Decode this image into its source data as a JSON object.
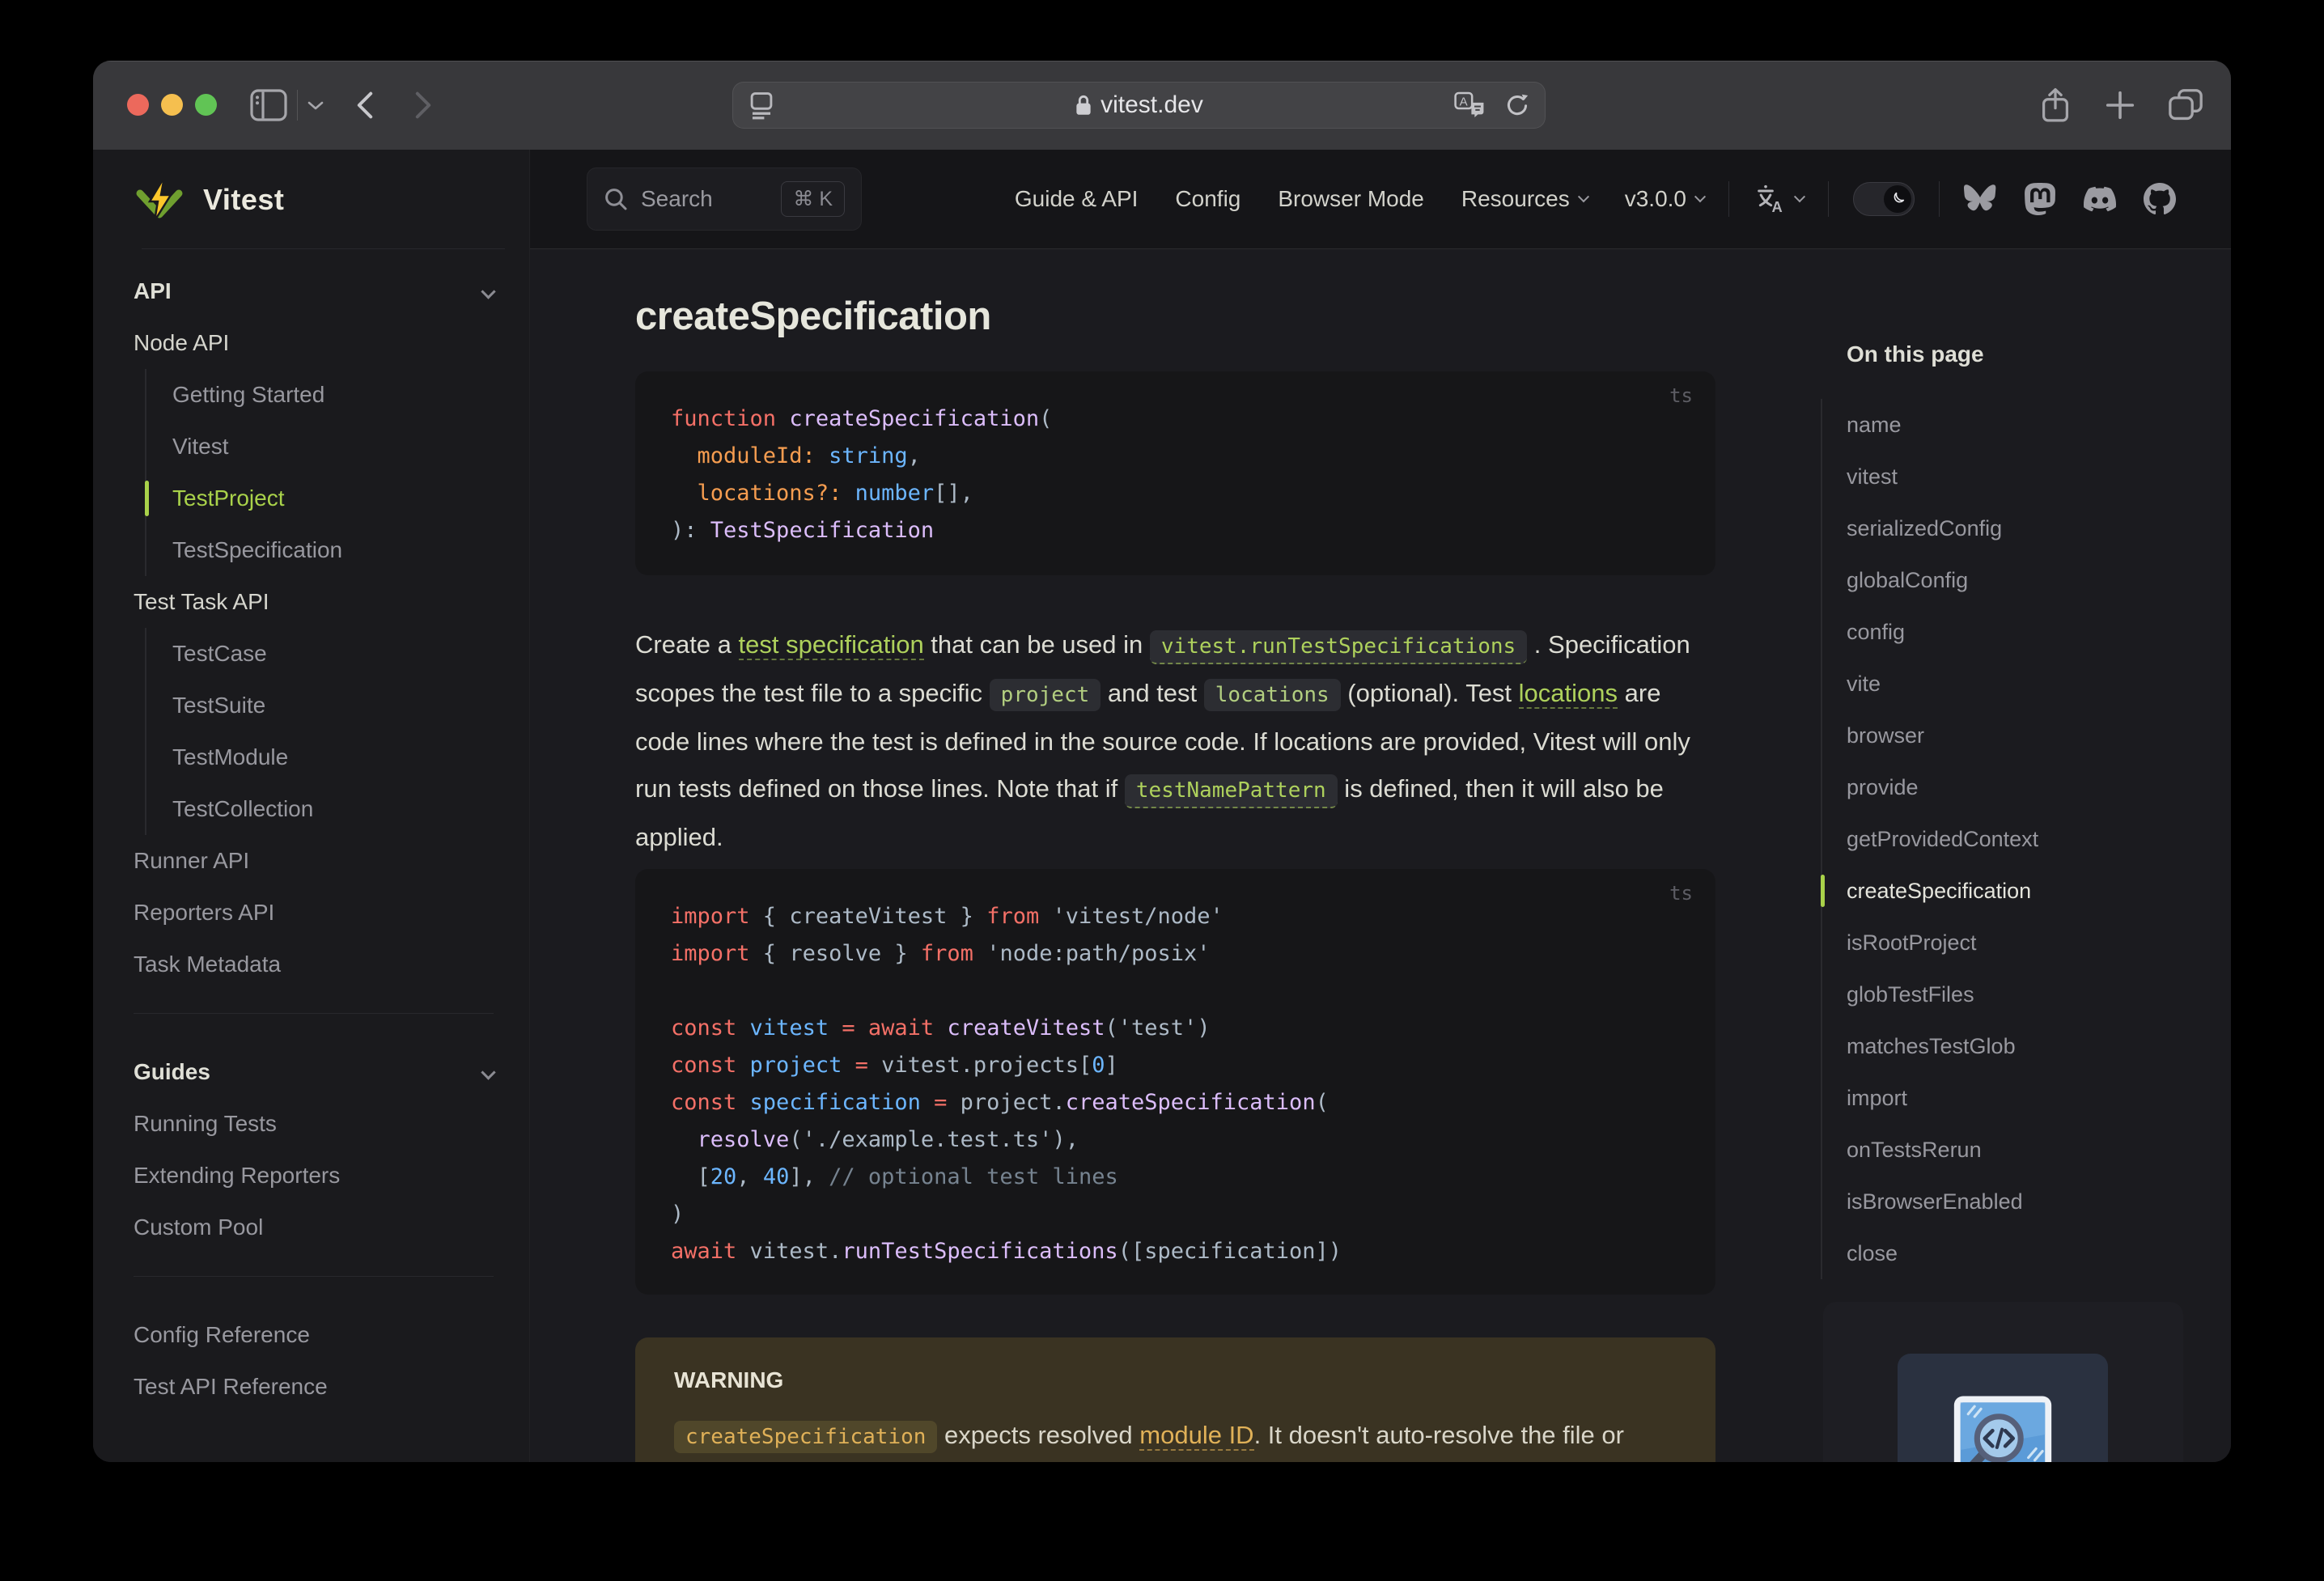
{
  "browser": {
    "url": "vitest.dev"
  },
  "nav": {
    "search_label": "Search",
    "search_shortcut": "⌘ K",
    "links": [
      {
        "label": "Guide & API"
      },
      {
        "label": "Config"
      },
      {
        "label": "Browser Mode"
      },
      {
        "label": "Resources",
        "chevron": true
      },
      {
        "label": "v3.0.0",
        "chevron": true
      }
    ],
    "socials": [
      "Bluesky",
      "Mastodon",
      "Discord",
      "GitHub"
    ]
  },
  "sidebar": {
    "logo_text": "Vitest",
    "sections": [
      {
        "title": "API",
        "items": [
          {
            "label": "Node API",
            "kind": "subheader"
          },
          {
            "label": "Getting Started",
            "kind": "nested"
          },
          {
            "label": "Vitest",
            "kind": "nested"
          },
          {
            "label": "TestProject",
            "kind": "nested",
            "active": true
          },
          {
            "label": "TestSpecification",
            "kind": "nested"
          },
          {
            "label": "Test Task API",
            "kind": "subheader"
          },
          {
            "label": "TestCase",
            "kind": "nested"
          },
          {
            "label": "TestSuite",
            "kind": "nested"
          },
          {
            "label": "TestModule",
            "kind": "nested"
          },
          {
            "label": "TestCollection",
            "kind": "nested"
          },
          {
            "label": "Runner API",
            "kind": "item"
          },
          {
            "label": "Reporters API",
            "kind": "item"
          },
          {
            "label": "Task Metadata",
            "kind": "item"
          }
        ]
      },
      {
        "title": "Guides",
        "items": [
          {
            "label": "Running Tests",
            "kind": "item"
          },
          {
            "label": "Extending Reporters",
            "kind": "item"
          },
          {
            "label": "Custom Pool",
            "kind": "item"
          }
        ]
      },
      {
        "title": null,
        "items": [
          {
            "label": "Config Reference",
            "kind": "item"
          },
          {
            "label": "Test API Reference",
            "kind": "item"
          }
        ]
      }
    ]
  },
  "page": {
    "heading": "createSpecification",
    "code_lang": "ts",
    "signature_code": {
      "lines": [
        [
          [
            "k",
            "function"
          ],
          [
            "p",
            " "
          ],
          [
            "f",
            "createSpecification"
          ],
          [
            "p",
            "("
          ]
        ],
        [
          [
            "p",
            "  "
          ],
          [
            "o",
            "moduleId:"
          ],
          [
            "p",
            " "
          ],
          [
            "b",
            "string"
          ],
          [
            "p",
            ","
          ]
        ],
        [
          [
            "p",
            "  "
          ],
          [
            "o",
            "locations?:"
          ],
          [
            "p",
            " "
          ],
          [
            "b",
            "number"
          ],
          [
            "p",
            "[],"
          ]
        ],
        [
          [
            "p",
            "): "
          ],
          [
            "f",
            "TestSpecification"
          ]
        ]
      ]
    },
    "paragraph": [
      [
        "t",
        "Create a "
      ],
      [
        "a",
        "test specification"
      ],
      [
        "t",
        " that can be used in "
      ],
      [
        "ac",
        "vitest.runTestSpecifications"
      ],
      [
        "t",
        " . Specification scopes the test file to a specific "
      ],
      [
        "c",
        "project"
      ],
      [
        "t",
        " and test "
      ],
      [
        "c",
        "locations"
      ],
      [
        "t",
        " (optional). Test "
      ],
      [
        "a",
        "locations"
      ],
      [
        "t",
        " are code lines where the test is defined in the source code. If locations are provided, Vitest will only run tests defined on those lines. Note that if "
      ],
      [
        "ac",
        "testNamePattern"
      ],
      [
        "t",
        " is defined, then it will also be applied."
      ]
    ],
    "example_code": {
      "lines": [
        [
          [
            "k",
            "import"
          ],
          [
            "p",
            " { "
          ],
          [
            "p",
            "createVitest"
          ],
          [
            "p",
            " } "
          ],
          [
            "k",
            "from"
          ],
          [
            "p",
            " "
          ],
          [
            "s",
            "'vitest/node'"
          ]
        ],
        [
          [
            "k",
            "import"
          ],
          [
            "p",
            " { "
          ],
          [
            "p",
            "resolve"
          ],
          [
            "p",
            " } "
          ],
          [
            "k",
            "from"
          ],
          [
            "p",
            " "
          ],
          [
            "s",
            "'node:path/posix'"
          ]
        ],
        [],
        [
          [
            "k",
            "const"
          ],
          [
            "p",
            " "
          ],
          [
            "b",
            "vitest"
          ],
          [
            "p",
            " "
          ],
          [
            "k",
            "="
          ],
          [
            "p",
            " "
          ],
          [
            "k",
            "await"
          ],
          [
            "p",
            " "
          ],
          [
            "f",
            "createVitest"
          ],
          [
            "p",
            "("
          ],
          [
            "s",
            "'test'"
          ],
          [
            "p",
            ")"
          ]
        ],
        [
          [
            "k",
            "const"
          ],
          [
            "p",
            " "
          ],
          [
            "b",
            "project"
          ],
          [
            "p",
            " "
          ],
          [
            "k",
            "="
          ],
          [
            "p",
            " "
          ],
          [
            "p",
            "vitest.projects["
          ],
          [
            "b",
            "0"
          ],
          [
            "p",
            "]"
          ]
        ],
        [
          [
            "k",
            "const"
          ],
          [
            "p",
            " "
          ],
          [
            "b",
            "specification"
          ],
          [
            "p",
            " "
          ],
          [
            "k",
            "="
          ],
          [
            "p",
            " "
          ],
          [
            "p",
            "project."
          ],
          [
            "f",
            "createSpecification"
          ],
          [
            "p",
            "("
          ]
        ],
        [
          [
            "p",
            "  "
          ],
          [
            "f",
            "resolve"
          ],
          [
            "p",
            "("
          ],
          [
            "s",
            "'./example.test.ts'"
          ],
          [
            "p",
            "),"
          ]
        ],
        [
          [
            "p",
            "  ["
          ],
          [
            "b",
            "20"
          ],
          [
            "p",
            ", "
          ],
          [
            "b",
            "40"
          ],
          [
            "p",
            "], "
          ],
          [
            "c",
            "// optional test lines"
          ]
        ],
        [
          [
            "p",
            ")"
          ]
        ],
        [
          [
            "k",
            "await"
          ],
          [
            "p",
            " vitest."
          ],
          [
            "f",
            "runTestSpecifications"
          ],
          [
            "p",
            "(["
          ],
          [
            "p",
            "specification"
          ],
          [
            "p",
            "])"
          ]
        ]
      ]
    },
    "warning": {
      "title": "WARNING",
      "body": [
        [
          "cw",
          "createSpecification"
        ],
        [
          "t",
          " expects resolved "
        ],
        [
          "aw",
          "module ID"
        ],
        [
          "t",
          ". It doesn't auto-resolve the file or check that it exists on the file system."
        ]
      ]
    }
  },
  "toc": {
    "title": "On this page",
    "items": [
      {
        "label": "name"
      },
      {
        "label": "vitest"
      },
      {
        "label": "serializedConfig"
      },
      {
        "label": "globalConfig"
      },
      {
        "label": "config"
      },
      {
        "label": "vite"
      },
      {
        "label": "browser"
      },
      {
        "label": "provide"
      },
      {
        "label": "getProvidedContext"
      },
      {
        "label": "createSpecification",
        "active": true
      },
      {
        "label": "isRootProject"
      },
      {
        "label": "globTestFiles"
      },
      {
        "label": "matchesTestGlob"
      },
      {
        "label": "import"
      },
      {
        "label": "onTestsRerun"
      },
      {
        "label": "isBrowserEnabled"
      },
      {
        "label": "close"
      }
    ]
  },
  "colors": {
    "brand_green": "#a9d24a",
    "warning_accent": "#e0b158",
    "code_keyword": "#f47067",
    "code_function": "#dcbdfb",
    "code_variable": "#6cb6ff",
    "code_param": "#f69d50",
    "code_plain": "#adbac7",
    "code_comment": "#768390",
    "traffic_red": "#ec695c",
    "traffic_yellow": "#f5bf4f",
    "traffic_green": "#61c455"
  }
}
